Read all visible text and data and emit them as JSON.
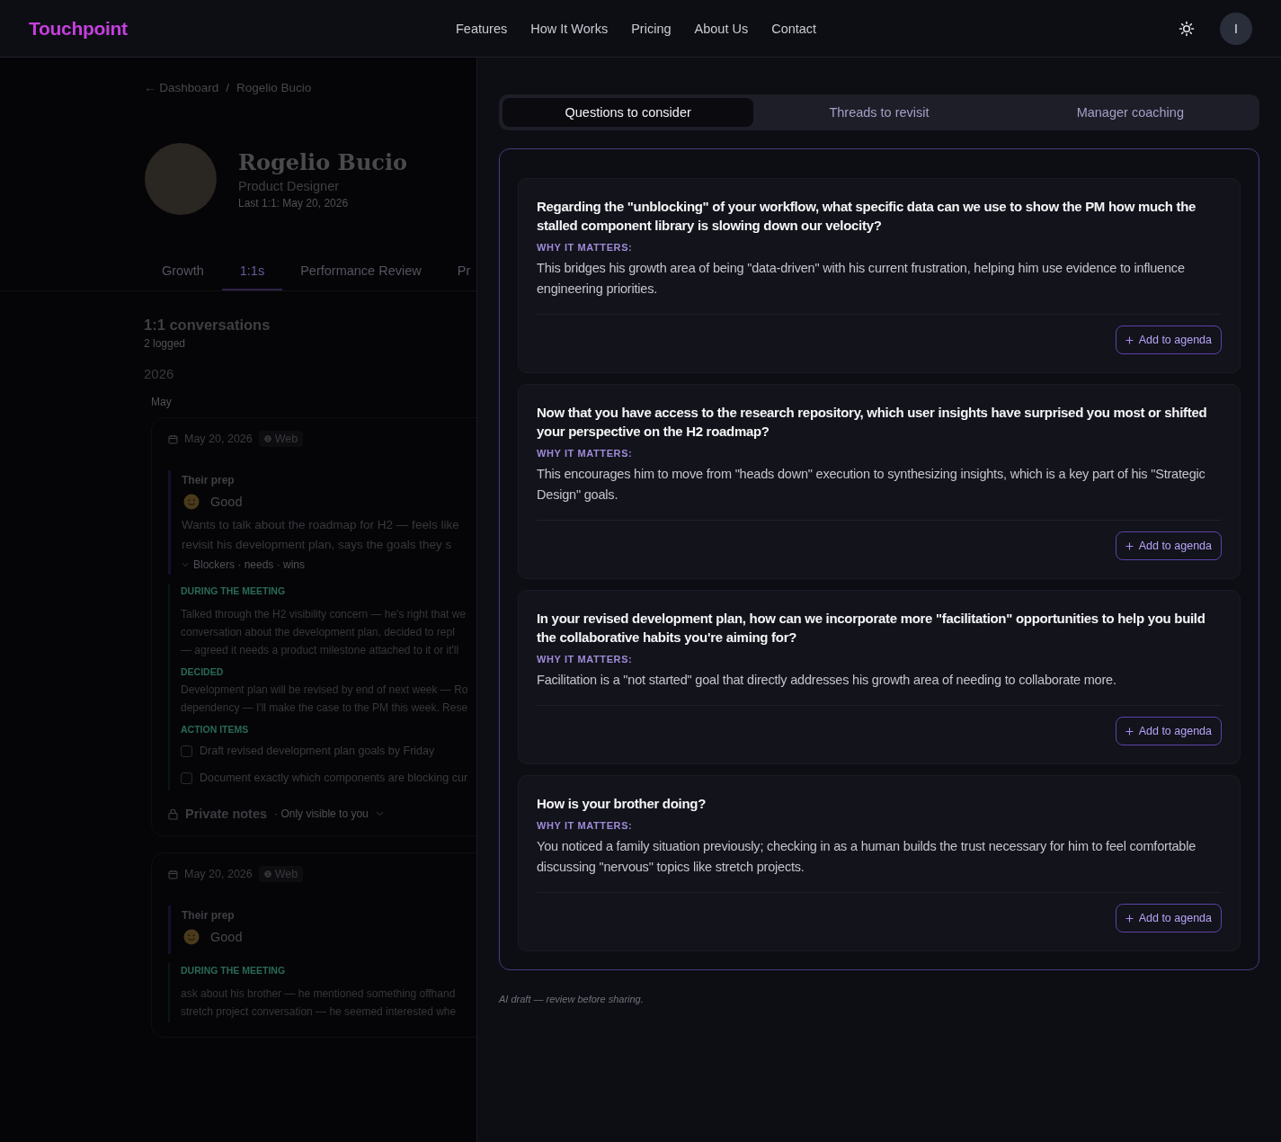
{
  "header": {
    "logo": "Touchpoint",
    "nav": [
      "Features",
      "How It Works",
      "Pricing",
      "About Us",
      "Contact"
    ],
    "avatar_initial": "I"
  },
  "background_page": {
    "breadcrumb": {
      "back": "← Dashboard",
      "separator": "/",
      "current": "Rogelio Bucio"
    },
    "profile": {
      "name": "Rogelio Bucio",
      "role": "Product Designer",
      "last_one_on_one": "Last 1:1: May 20, 2026"
    },
    "tabs": [
      {
        "label": "Growth",
        "selected": false
      },
      {
        "label": "1:1s",
        "selected": true
      },
      {
        "label": "Performance Review",
        "selected": false
      },
      {
        "label": "Pr",
        "selected": false
      }
    ],
    "section": {
      "title": "1:1 conversations",
      "count": "2 logged"
    },
    "year": "2026",
    "month": "May",
    "conversations": [
      {
        "date": "May 20, 2026",
        "channel": "Web",
        "prep_label": "Their prep",
        "mood": "Good",
        "prep_lines": [
          "Wants to talk about the roadmap for H2 — feels like",
          "revisit his development plan, says the goals they s"
        ],
        "prep_toggle": "Blockers · needs · wins",
        "meeting_label": "DURING THE MEETING",
        "meeting_lines": [
          "Talked through the H2 visibility concern — he's right that we",
          "conversation about the development plan, decided to repl",
          "— agreed it needs a product milestone attached to it or it'll"
        ],
        "decided_label": "DECIDED",
        "decided_lines": [
          "Development plan will be revised by end of next week — Ro",
          "dependency — I'll make the case to the PM this week. Rese"
        ],
        "action_label": "ACTION ITEMS",
        "action_items": [
          {
            "text": "Draft revised development plan goals by Friday",
            "checked": false
          },
          {
            "text": "Document exactly which components are blocking cur",
            "checked": false
          }
        ],
        "private_notes": {
          "title": "Private notes",
          "hint": "· Only visible to you"
        }
      },
      {
        "date": "May 20, 2026",
        "channel": "Web",
        "prep_label": "Their prep",
        "mood": "Good",
        "meeting_label": "DURING THE MEETING",
        "meeting_lines": [
          "ask about his brother — he mentioned something offhand",
          "stretch project conversation — he seemed interested whe"
        ]
      }
    ]
  },
  "drawer": {
    "tabs": [
      {
        "label": "Questions to consider",
        "selected": true
      },
      {
        "label": "Threads to revisit",
        "selected": false
      },
      {
        "label": "Manager coaching",
        "selected": false
      }
    ],
    "questions": [
      {
        "question": "Regarding the \"unblocking\" of your workflow, what specific data can we use to show the PM how much the stalled component library is slowing down our velocity?",
        "why_label": "WHY IT MATTERS:",
        "why": "This bridges his growth area of being \"data-driven\" with his current frustration, helping him use evidence to influence engineering priorities.",
        "button": "Add to agenda"
      },
      {
        "question": "Now that you have access to the research repository, which user insights have surprised you most or shifted your perspective on the H2 roadmap?",
        "why_label": "WHY IT MATTERS:",
        "why": "This encourages him to move from \"heads down\" execution to synthesizing insights, which is a key part of his \"Strategic Design\" goals.",
        "button": "Add to agenda"
      },
      {
        "question": "In your revised development plan, how can we incorporate more \"facilitation\" opportunities to help you build the collaborative habits you're aiming for?",
        "why_label": "WHY IT MATTERS:",
        "why": "Facilitation is a \"not started\" goal that directly addresses his growth area of needing to collaborate more.",
        "button": "Add to agenda"
      },
      {
        "question": "How is your brother doing?",
        "why_label": "WHY IT MATTERS:",
        "why": "You noticed a family situation previously; checking in as a human builds the trust necessary for him to feel comfortable discussing \"nervous\" topics like stretch projects.",
        "button": "Add to agenda"
      }
    ],
    "footnote": "AI draft — review before sharing."
  }
}
